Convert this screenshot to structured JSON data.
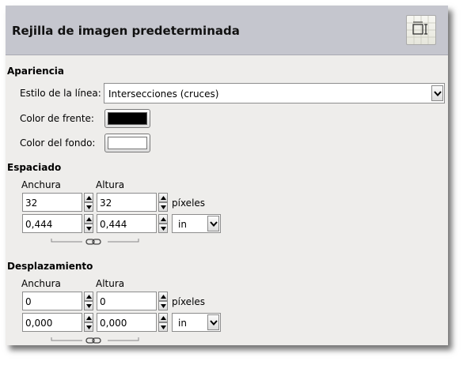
{
  "header": {
    "title": "Rejilla de imagen predeterminada",
    "icon": "grid-icon"
  },
  "appearance": {
    "title": "Apariencia",
    "line_style_label": "Estilo de la línea:",
    "line_style_value": "Intersecciones (cruces)",
    "fg_label": "Color de frente:",
    "fg_color": "#000000",
    "bg_label": "Color del fondo:",
    "bg_color": "#ffffff"
  },
  "spacing": {
    "title": "Espaciado",
    "width_label": "Anchura",
    "height_label": "Altura",
    "width_px": "32",
    "height_px": "32",
    "px_unit": "píxeles",
    "width_unit": "0,444",
    "height_unit": "0,444",
    "unit": "in"
  },
  "offset": {
    "title": "Desplazamiento",
    "width_label": "Anchura",
    "height_label": "Altura",
    "width_px": "0",
    "height_px": "0",
    "px_unit": "píxeles",
    "width_unit": "0,000",
    "height_unit": "0,000",
    "unit": "in"
  }
}
